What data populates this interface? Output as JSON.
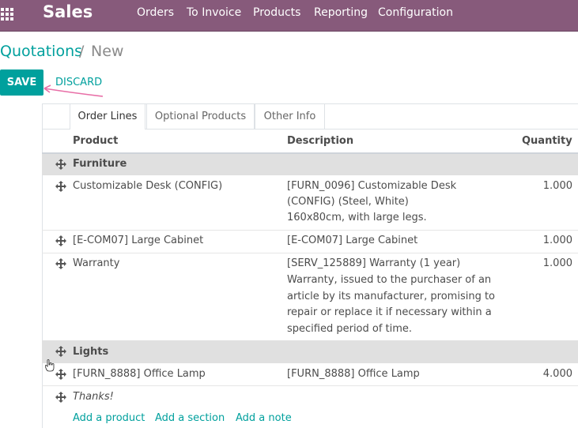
{
  "topbar": {
    "brand": "Sales",
    "menu": [
      "Orders",
      "To Invoice",
      "Products",
      "Reporting",
      "Configuration"
    ]
  },
  "breadcrumb": {
    "parent": "Quotations",
    "separator": "/",
    "current": "New"
  },
  "buttons": {
    "save": "SAVE",
    "discard": "DISCARD"
  },
  "tabs": [
    "Order Lines",
    "Optional Products",
    "Other Info"
  ],
  "columns": {
    "product": "Product",
    "description": "Description",
    "quantity": "Quantity"
  },
  "lines": [
    {
      "kind": "section",
      "label": "Furniture"
    },
    {
      "kind": "product",
      "product": "Customizable Desk (CONFIG)",
      "description": [
        "[FURN_0096] Customizable Desk",
        "(CONFIG) (Steel, White)",
        "160x80cm, with large legs."
      ],
      "quantity": "1.000"
    },
    {
      "kind": "product",
      "product": "[E-COM07] Large Cabinet",
      "description": [
        "[E-COM07] Large Cabinet"
      ],
      "quantity": "1.000"
    },
    {
      "kind": "product",
      "product": "Warranty",
      "description": [
        "[SERV_125889] Warranty (1 year)",
        "Warranty, issued to the purchaser of an",
        "article by its manufacturer, promising to",
        "repair or replace it if necessary within a",
        "specified period of time."
      ],
      "quantity": "1.000"
    },
    {
      "kind": "section",
      "label": "Lights"
    },
    {
      "kind": "product",
      "product": "[FURN_8888] Office Lamp",
      "description": [
        "[FURN_8888] Office Lamp"
      ],
      "quantity": "4.000"
    },
    {
      "kind": "note",
      "label": "Thanks!"
    }
  ],
  "add_links": {
    "product": "Add a product",
    "section": "Add a section",
    "note": "Add a note"
  },
  "colors": {
    "topbar": "#875a7b",
    "accent": "#00a09d",
    "section_bg": "#e0e0e0",
    "annotation": "#e86fa7"
  }
}
